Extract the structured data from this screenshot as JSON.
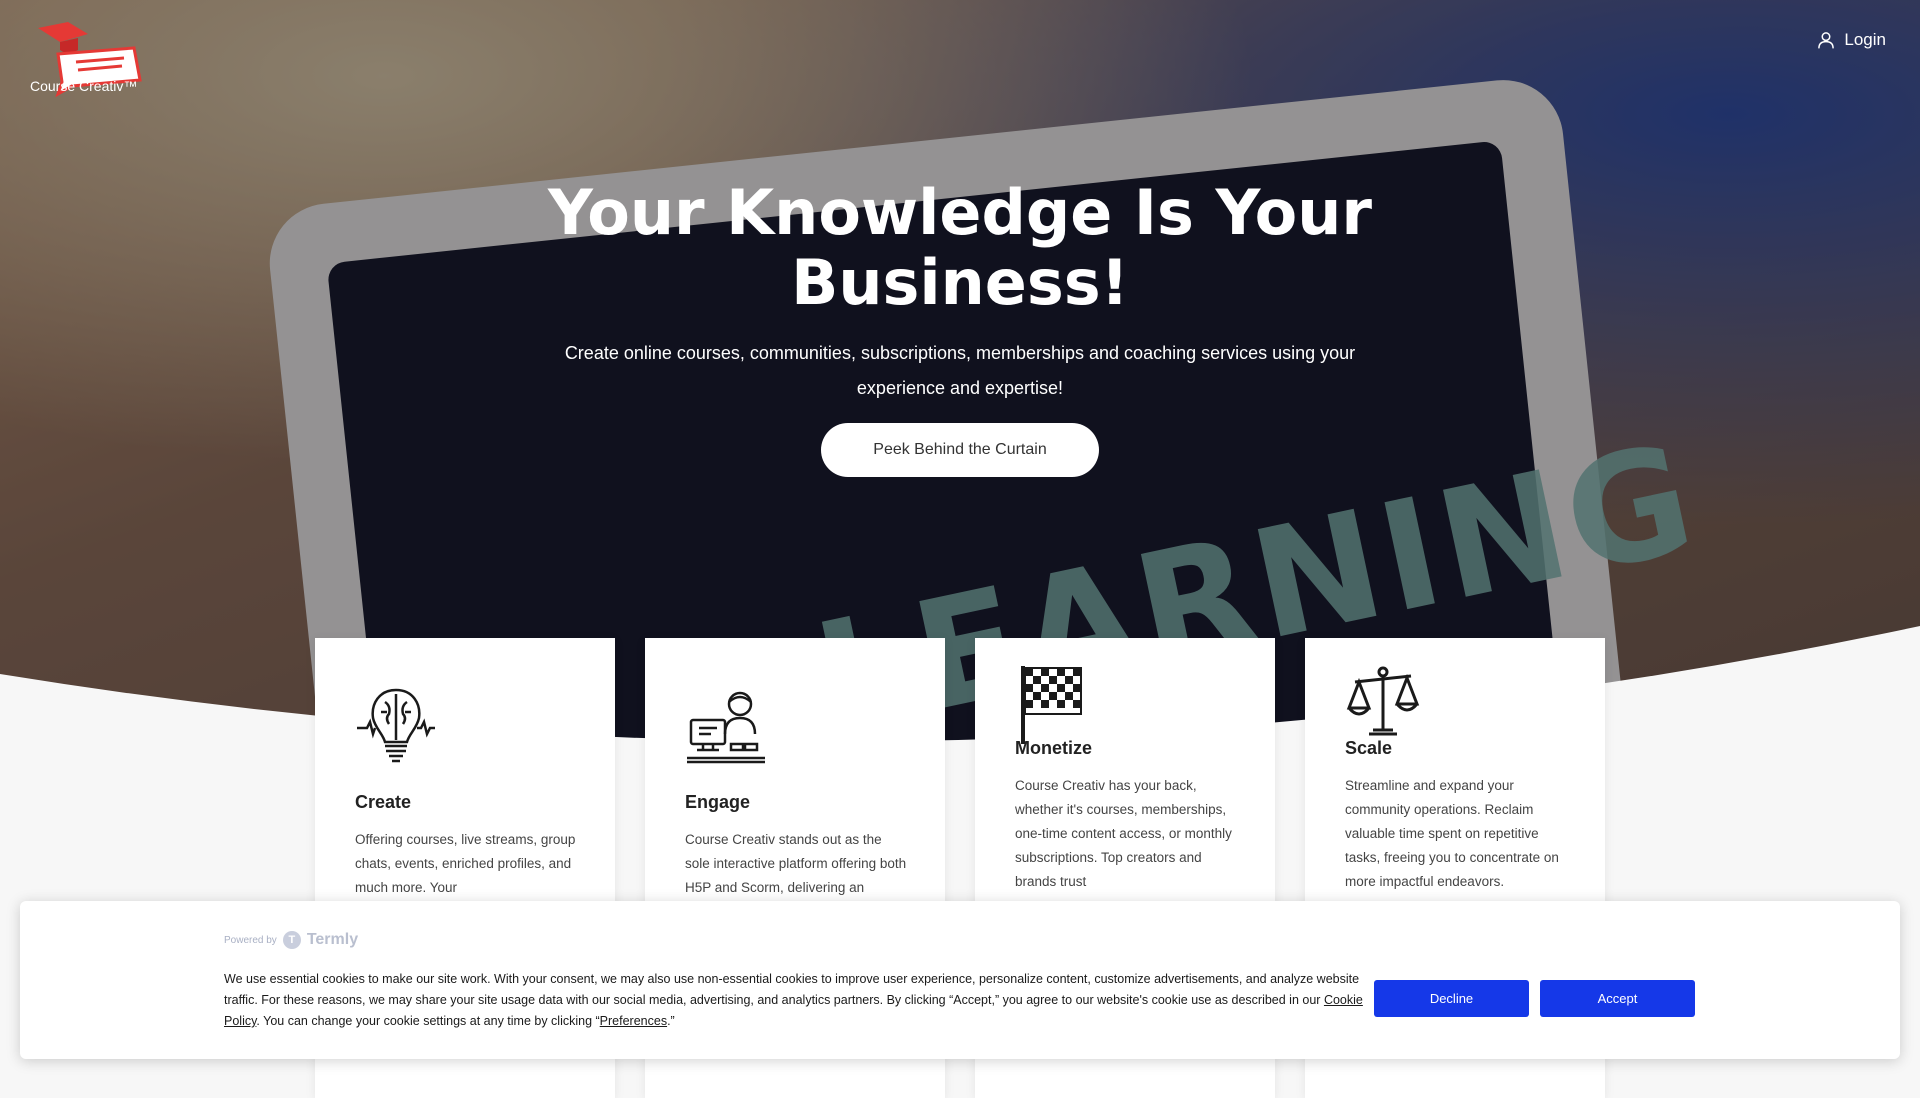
{
  "header": {
    "brand": "Course Creativ™",
    "login_label": "Login"
  },
  "hero": {
    "title_line1": "Your Knowledge Is Your",
    "title_line2": "Business!",
    "subtitle": "Create online courses, communities, subscriptions, memberships and coaching services using your experience and expertise!",
    "cta_label": "Peek Behind the Curtain",
    "background_word": "E-LEARNING"
  },
  "cards": [
    {
      "icon": "brain-lightbulb-icon",
      "title": "Create",
      "text": "Offering courses, live streams, group chats, events, enriched profiles, and much more. Your"
    },
    {
      "icon": "person-at-computer-icon",
      "title": "Engage",
      "text": "Course Creativ stands out as the sole interactive platform offering both H5P and Scorm, delivering an"
    },
    {
      "icon": "checkered-flag-icon",
      "title": "Monetize",
      "text": "Course Creativ has your back, whether it's courses, memberships, one-time content access, or monthly subscriptions. Top creators and brands trust"
    },
    {
      "icon": "balance-scale-icon",
      "title": "Scale",
      "text": "Streamline and expand your community operations. Reclaim valuable time spent on repetitive tasks, freeing you to concentrate on more impactful endeavors."
    }
  ],
  "cookie_banner": {
    "powered_by": "Powered by",
    "provider": "Termly",
    "text_part1": "We use essential cookies to make our site work. With your consent, we may also use non-essential cookies to improve user experience, personalize content, customize advertisements, and analyze website traffic. For these reasons, we may share your site usage data with our social media, advertising, and analytics partners. By clicking “Accept,” you agree to our website's cookie use as described in our",
    "cookie_policy_link": "Cookie Policy",
    "text_part2": ". You can change your cookie settings at any time by clicking “",
    "preferences_link": "Preferences",
    "text_part3": ".”",
    "decline_label": "Decline",
    "accept_label": "Accept"
  },
  "colors": {
    "accent_button": "#1538e8",
    "logo_red": "#e53935"
  }
}
